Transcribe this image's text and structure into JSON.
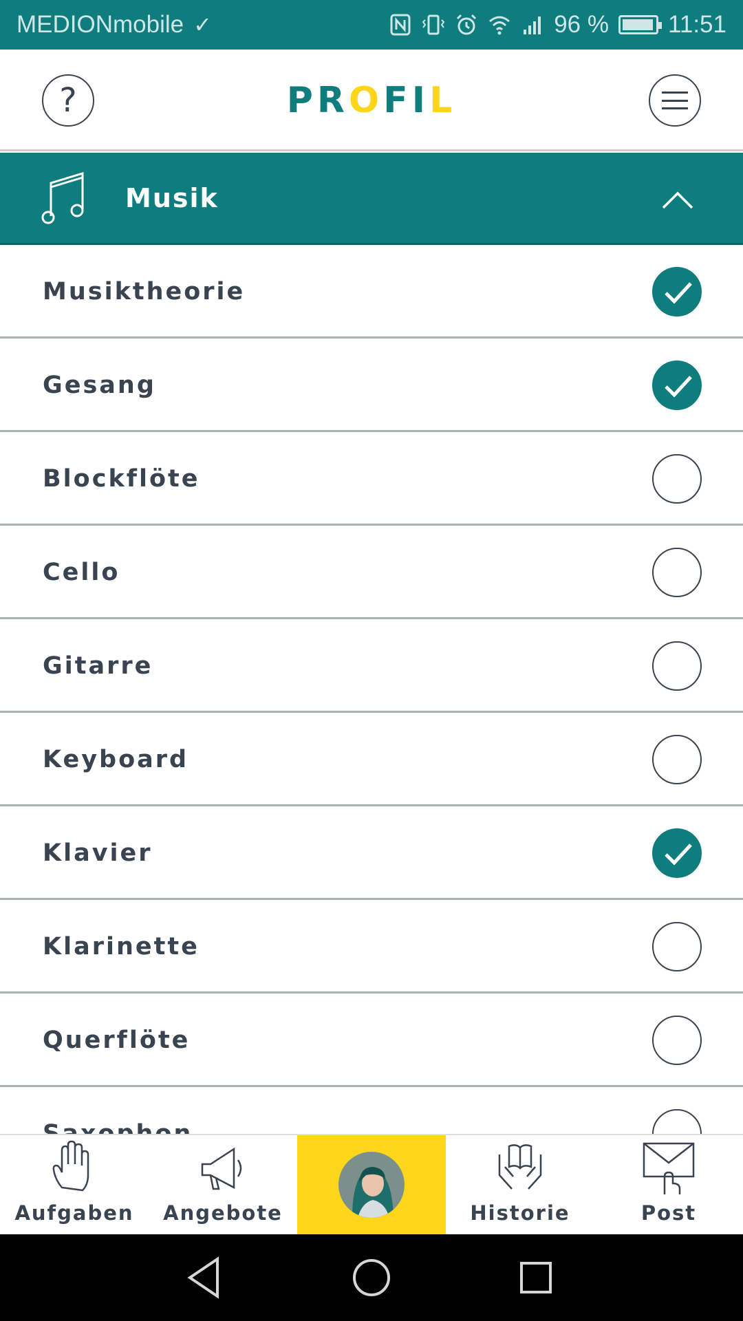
{
  "status_bar": {
    "carrier": "MEDIONmobile",
    "battery_percent": "96 %",
    "battery_level": 0.96,
    "time": "11:51",
    "icons": [
      "check-icon",
      "nfc-icon",
      "vibrate-icon",
      "alarm-icon",
      "wifi-icon",
      "signal-icon",
      "battery-icon"
    ]
  },
  "header": {
    "title_letters": [
      {
        "char": "P",
        "color": "#0f7d7e"
      },
      {
        "char": "R",
        "color": "#0f7d7e"
      },
      {
        "char": "O",
        "color": "#fdd61c"
      },
      {
        "char": "F",
        "color": "#0f7d7e"
      },
      {
        "char": "I",
        "color": "#0f7d7e"
      },
      {
        "char": "L",
        "color": "#fdd61c"
      }
    ],
    "help_symbol": "?"
  },
  "section": {
    "label": "Musik",
    "expanded": true
  },
  "instruments": [
    {
      "label": "Musiktheorie",
      "checked": true
    },
    {
      "label": "Gesang",
      "checked": true
    },
    {
      "label": "Blockflöte",
      "checked": false
    },
    {
      "label": "Cello",
      "checked": false
    },
    {
      "label": "Gitarre",
      "checked": false
    },
    {
      "label": "Keyboard",
      "checked": false
    },
    {
      "label": "Klavier",
      "checked": true
    },
    {
      "label": "Klarinette",
      "checked": false
    },
    {
      "label": "Querflöte",
      "checked": false
    },
    {
      "label": "Saxophon",
      "checked": false
    }
  ],
  "bottom_nav": {
    "aufgaben": "Aufgaben",
    "angebote": "Angebote",
    "historie": "Historie",
    "post": "Post",
    "active": "profile"
  },
  "colors": {
    "primary": "#0f7d7e",
    "accent": "#fdd61c",
    "text": "#3a4350"
  }
}
